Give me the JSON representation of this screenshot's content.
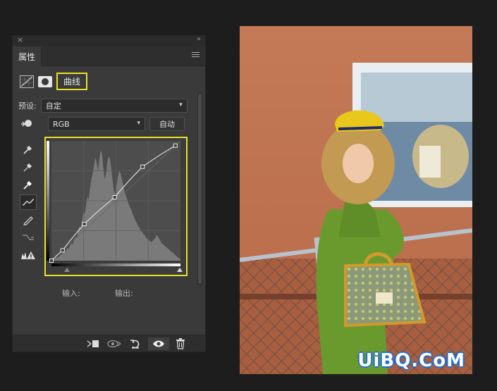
{
  "panel": {
    "close_glyph": "×",
    "collapse_glyph": "»",
    "tab_label": "属性",
    "adjustment_title": "曲线",
    "preset_label": "预设:",
    "preset_value": "自定",
    "channel_value": "RGB",
    "auto_label": "自动",
    "input_label": "输入:",
    "output_label": "输出:"
  },
  "tools": [
    "eyedropper-black-icon",
    "eyedropper-gray-icon",
    "eyedropper-white-icon",
    "curve-point-icon",
    "pencil-icon",
    "smooth-icon",
    "clipping-warning-icon"
  ],
  "bottom_bar": [
    "clip-to-layer-icon",
    "view-previous-icon",
    "reset-icon",
    "visibility-eye-icon",
    "trash-icon"
  ],
  "chart_data": {
    "type": "line",
    "title": "",
    "xlabel": "",
    "ylabel": "",
    "xlim": [
      0,
      255
    ],
    "ylim": [
      0,
      255
    ],
    "grid": true,
    "series": [
      {
        "points": [
          [
            0,
            0
          ],
          [
            22,
            22
          ],
          [
            65,
            78
          ],
          [
            125,
            135
          ],
          [
            180,
            200
          ],
          [
            245,
            245
          ]
        ]
      }
    ],
    "histogram": [
      2,
      3,
      3,
      4,
      5,
      6,
      8,
      10,
      12,
      15,
      14,
      18,
      22,
      20,
      26,
      30,
      28,
      35,
      42,
      38,
      50,
      60,
      55,
      70,
      85,
      80,
      95,
      110,
      105,
      125,
      140,
      150,
      165,
      178,
      170,
      155,
      175,
      190,
      185,
      160,
      140,
      150,
      170,
      180,
      175,
      158,
      138,
      120,
      115,
      130,
      145,
      155,
      150,
      140,
      130,
      118,
      112,
      105,
      98,
      92,
      88,
      80,
      76,
      70,
      66,
      60,
      58,
      52,
      50,
      46,
      44,
      40,
      38,
      36,
      34,
      32,
      34,
      36,
      40,
      44,
      42,
      38,
      34,
      30,
      28,
      26,
      24,
      22,
      20,
      18,
      16,
      14,
      12,
      10,
      8,
      6,
      4,
      3
    ]
  },
  "colors": {
    "highlight": "#e8e02a",
    "panel_bg": "#3a3a3a",
    "wall": "#c0734f",
    "dress": "#6a9a2e",
    "hat": "#e8c81a"
  },
  "watermark": "UiBQ.CoM"
}
